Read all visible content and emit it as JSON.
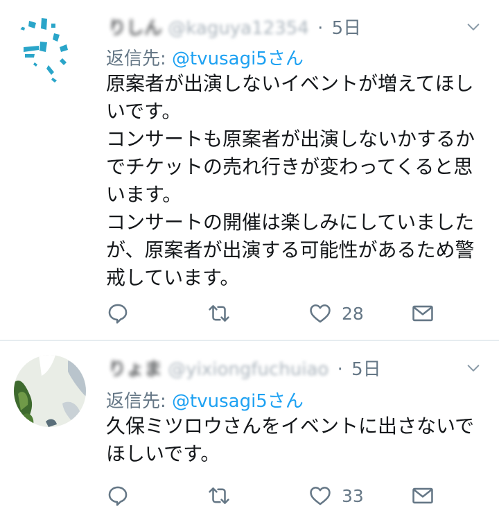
{
  "tweets": [
    {
      "name": "りしん",
      "handle": "@kaguya12354",
      "dot": "·",
      "time": "5日",
      "reply_label": "返信先: ",
      "reply_mention": "@tvusagi5さん",
      "text": "原案者が出演しないイベントが増えてほしいです。\nコンサートも原案者が出演しないかするかでチケットの売れ行きが変わってくると思います。\nコンサートの開催は楽しみにしていましたが、原案者が出演する可能性があるため警戒しています。",
      "likes": "28",
      "icons": [
        "reply-icon",
        "retweet-icon",
        "heart-icon",
        "dm-icon",
        "chevron-down-icon"
      ]
    },
    {
      "name": "りょま",
      "handle": "@yixiongfuchuiao",
      "dot": "·",
      "time": "5日",
      "reply_label": "返信先: ",
      "reply_mention": "@tvusagi5さん",
      "text": "久保ミツロウさんをイベントに出さないでほしいです。",
      "likes": "33",
      "icons": [
        "reply-icon",
        "retweet-icon",
        "heart-icon",
        "dm-icon",
        "chevron-down-icon"
      ]
    }
  ],
  "colors": {
    "accent": "#1da1f2",
    "muted": "#657786",
    "text": "#14171a",
    "divider": "#e6ecf0"
  }
}
